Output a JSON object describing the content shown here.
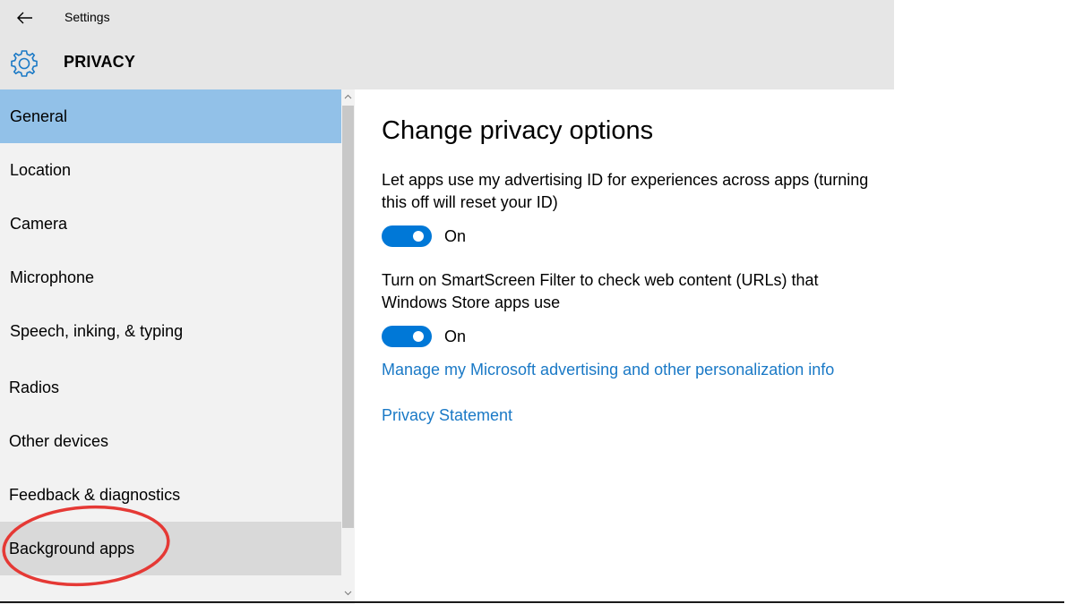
{
  "window": {
    "title": "Settings",
    "section_heading": "PRIVACY"
  },
  "sidebar": {
    "items": [
      {
        "label": "General",
        "state": "selected"
      },
      {
        "label": "Location",
        "state": ""
      },
      {
        "label": "Camera",
        "state": ""
      },
      {
        "label": "Microphone",
        "state": ""
      },
      {
        "label": "Speech, inking, & typing",
        "state": ""
      },
      {
        "label": "Radios",
        "state": ""
      },
      {
        "label": "Other devices",
        "state": ""
      },
      {
        "label": "Feedback & diagnostics",
        "state": ""
      },
      {
        "label": "Background apps",
        "state": "hover"
      }
    ]
  },
  "content": {
    "title": "Change privacy options",
    "settings": [
      {
        "description": "Let apps use my advertising ID for experiences across apps (turning this off will reset your ID)",
        "toggle_on": true,
        "toggle_label": "On"
      },
      {
        "description": "Turn on SmartScreen Filter to check web content (URLs) that Windows Store apps use",
        "toggle_on": true,
        "toggle_label": "On"
      }
    ],
    "links": {
      "manage_advertising": "Manage my Microsoft advertising and other personalization info",
      "privacy_statement": "Privacy Statement"
    }
  },
  "colors": {
    "accent": "#0078d7",
    "selected_item": "#92c1e8",
    "link": "#1a79c6",
    "annotation": "#e53935"
  },
  "icons": {
    "back": "back-arrow-icon",
    "section": "gear-icon"
  }
}
